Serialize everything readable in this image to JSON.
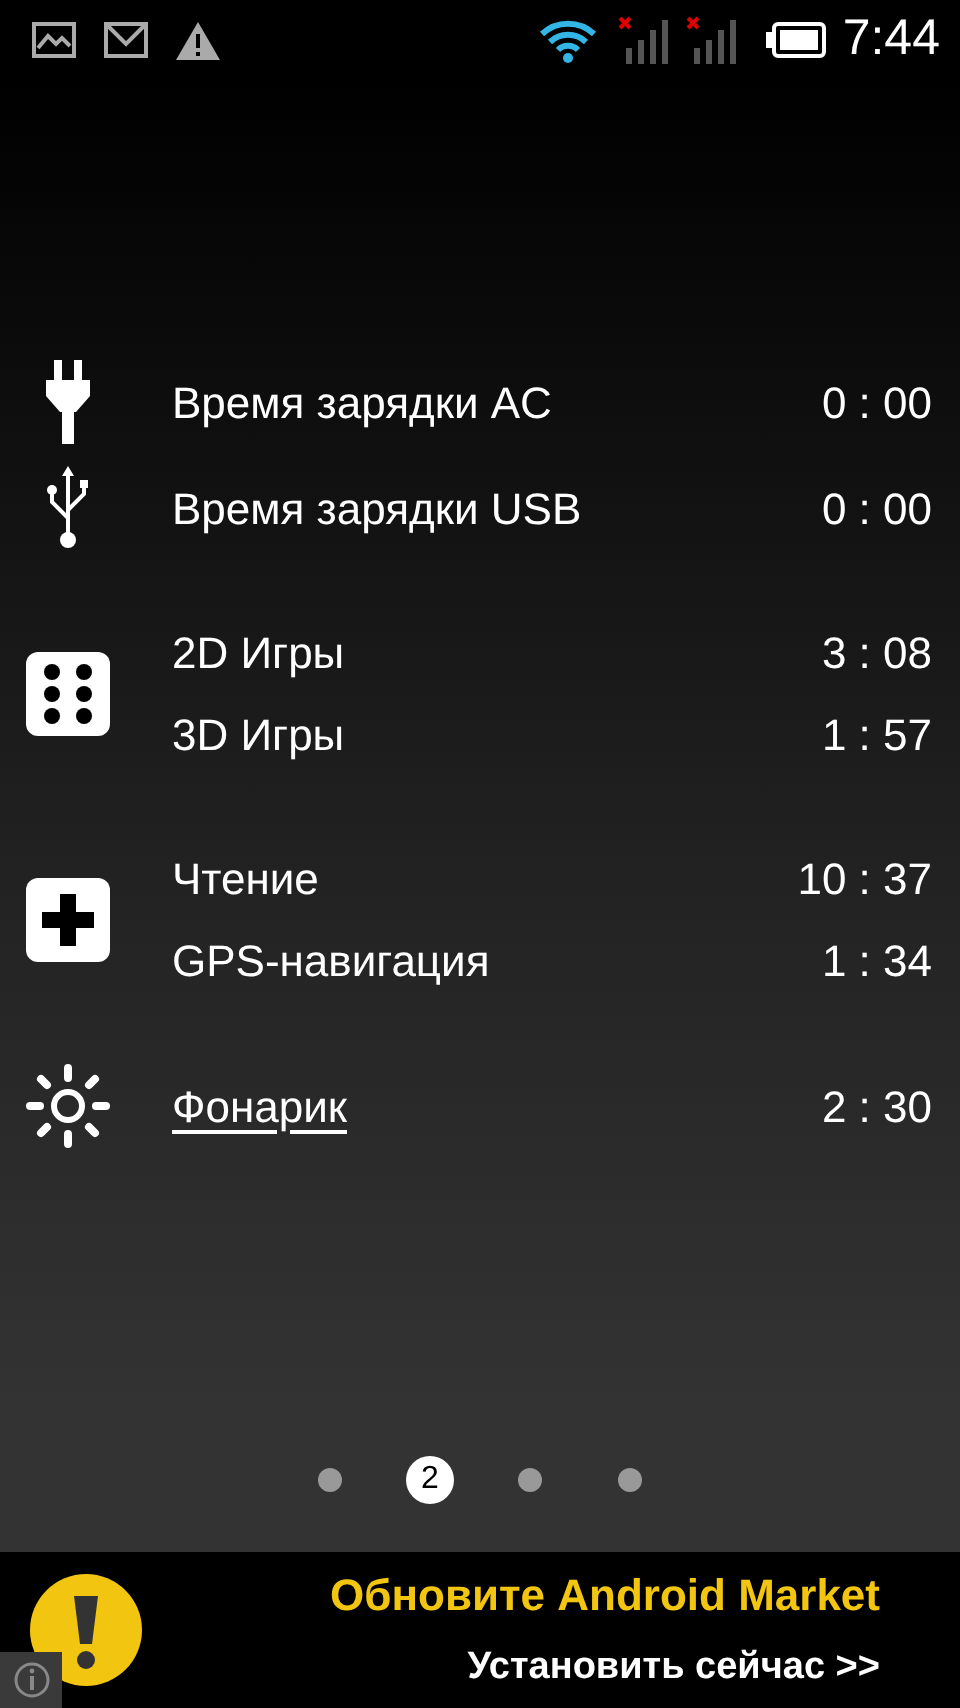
{
  "status_bar": {
    "time": "7:44"
  },
  "groups": [
    {
      "kind": "plug",
      "rows": [
        {
          "label": "Время зарядки AC",
          "time": "0 : 00",
          "underlined": false
        }
      ]
    },
    {
      "kind": "usb",
      "rows": [
        {
          "label": "Время зарядки USB",
          "time": "0 : 00",
          "underlined": false
        }
      ]
    },
    {
      "kind": "dice",
      "rows": [
        {
          "label": "2D Игры",
          "time": "3 : 08",
          "underlined": false
        },
        {
          "label": "3D Игры",
          "time": "1 : 57",
          "underlined": false
        }
      ]
    },
    {
      "kind": "plus",
      "rows": [
        {
          "label": "Чтение",
          "time": "10 : 37",
          "underlined": false
        },
        {
          "label": "GPS-навигация",
          "time": "1 : 34",
          "underlined": false
        }
      ]
    },
    {
      "kind": "sun",
      "rows": [
        {
          "label": "Фонарик",
          "time": "2 : 30",
          "underlined": true
        }
      ]
    }
  ],
  "pages": [
    {
      "selected": false
    },
    {
      "selected": true,
      "label": "2"
    },
    {
      "selected": false
    },
    {
      "selected": false
    }
  ],
  "ad": {
    "title": "Обновите Android Market",
    "action": "Установить сейчас >>"
  }
}
